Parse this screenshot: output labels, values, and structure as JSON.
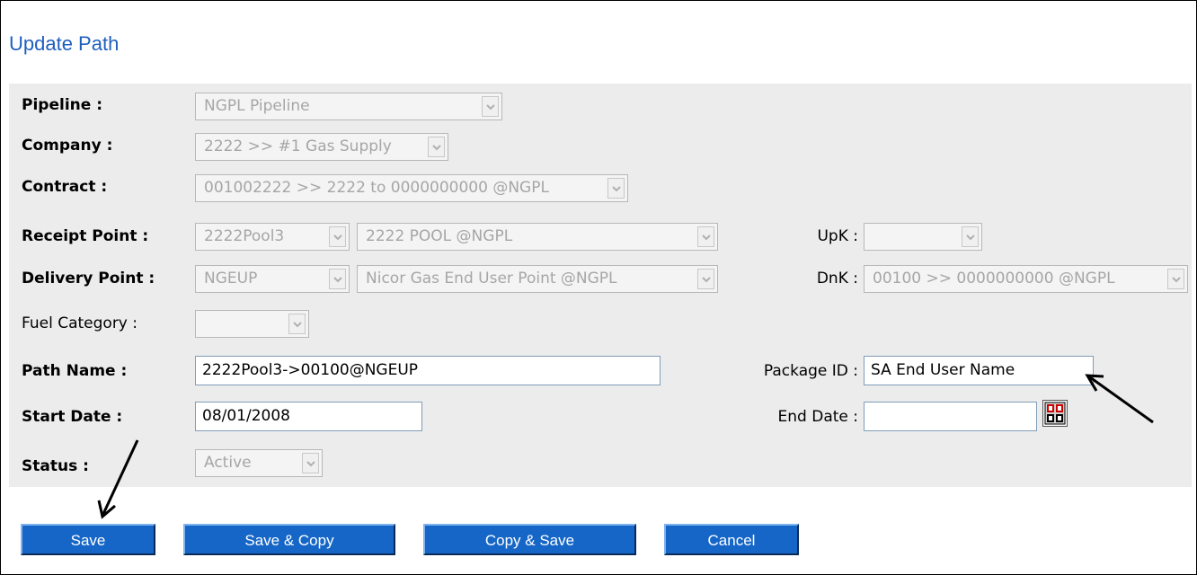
{
  "page_title": "Update Path",
  "form": {
    "pipeline": {
      "label": "Pipeline :",
      "value": "NGPL Pipeline"
    },
    "company": {
      "label": "Company :",
      "value": "2222 >> #1 Gas Supply"
    },
    "contract": {
      "label": "Contract :",
      "value": "001002222 >> 2222 to 0000000000 @NGPL"
    },
    "receipt_point": {
      "label": "Receipt Point :",
      "code": "2222Pool3",
      "name": "2222 POOL @NGPL"
    },
    "upk": {
      "label": "UpK :",
      "value": ""
    },
    "delivery_point": {
      "label": "Delivery Point :",
      "code": "NGEUP",
      "name": "Nicor Gas End User Point @NGPL"
    },
    "dnk": {
      "label": "DnK :",
      "value": "00100 >> 0000000000 @NGPL"
    },
    "fuel_category": {
      "label": "Fuel Category :",
      "value": ""
    },
    "path_name": {
      "label": "Path Name :",
      "value": "2222Pool3->00100@NGEUP"
    },
    "package_id": {
      "label": "Package ID :",
      "value": "SA End User Name"
    },
    "start_date": {
      "label": "Start Date :",
      "value": "08/01/2008"
    },
    "end_date": {
      "label": "End Date :",
      "value": ""
    },
    "status": {
      "label": "Status :",
      "value": "Active"
    },
    "calendar_icon": "calendar-icon"
  },
  "buttons": {
    "save": "Save",
    "save_copy": "Save & Copy",
    "copy_save": "Copy & Save",
    "cancel": "Cancel"
  }
}
